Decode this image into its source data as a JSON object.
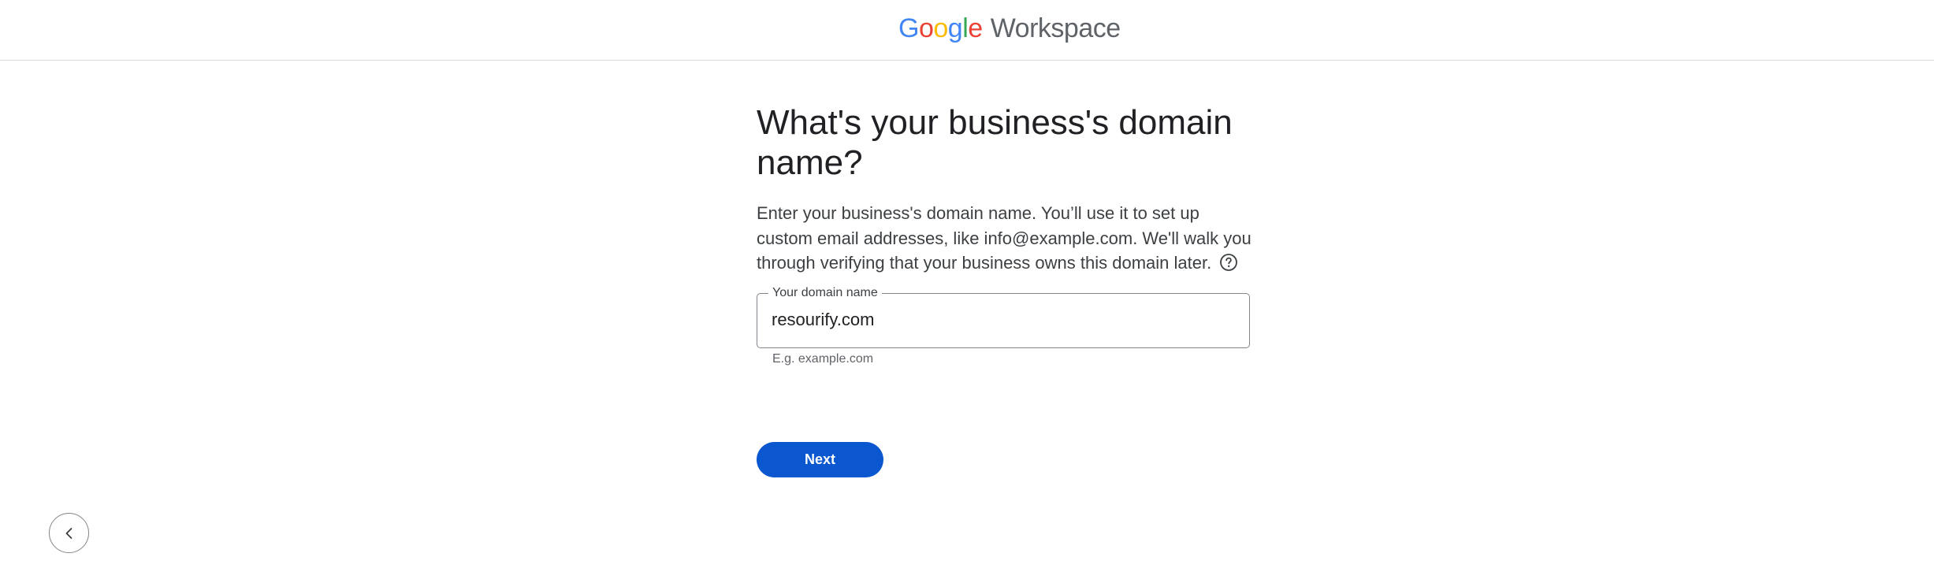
{
  "header": {
    "logo_google": "Google",
    "logo_product": "Workspace",
    "logo_colors": [
      "#4285F4",
      "#EA4335",
      "#FBBC05",
      "#4285F4",
      "#34A853",
      "#EA4335"
    ]
  },
  "main": {
    "title": "What's your business's domain name?",
    "description": "Enter your business's domain name. You’ll use it to set up custom email addresses, like info@example.com. We'll walk you through verifying that your business owns this domain later.",
    "help_icon": "help-circle-icon",
    "domain_field": {
      "label": "Your domain name",
      "value": "resourify.com",
      "helper": "E.g. example.com"
    },
    "next_label": "Next"
  },
  "navigation": {
    "back_icon": "chevron-left-icon"
  },
  "colors": {
    "accent": "#0b57d0",
    "text": "#202124",
    "border": "#80868b"
  }
}
